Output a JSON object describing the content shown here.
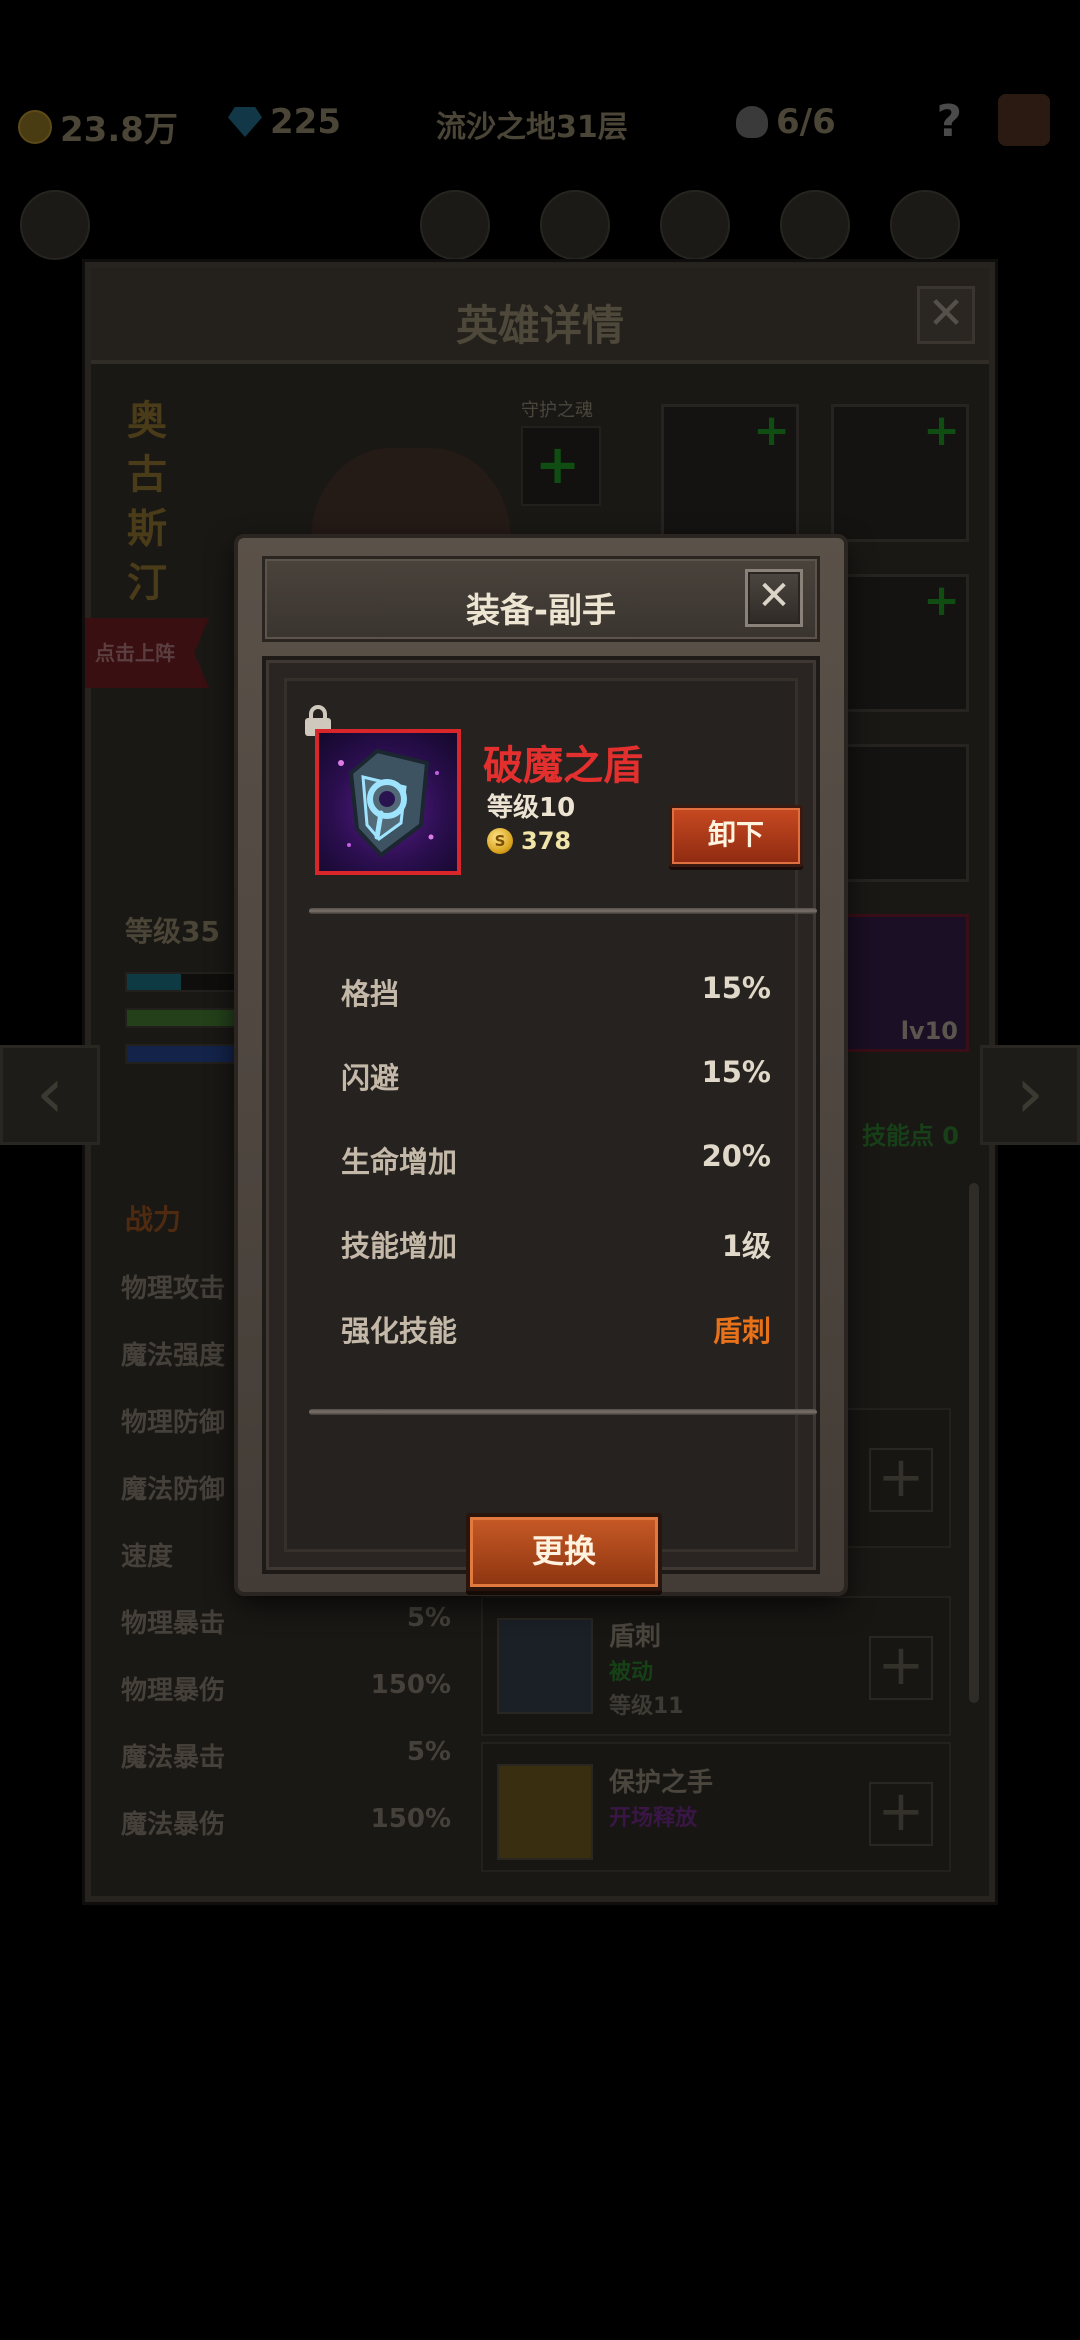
{
  "topbar": {
    "gold": "23.8万",
    "gems": "225",
    "stage": "流沙之地31层",
    "skulls": "6/6",
    "help": "?"
  },
  "hero_panel": {
    "title": "英雄详情",
    "close": "✕",
    "hero_name": "奥古斯汀",
    "guard_label": "守护之魂",
    "tap_deploy": "点击上阵",
    "level": "等级35",
    "skill_points": "技能点 0",
    "power_label": "战力",
    "stats": [
      {
        "label": "物理攻击",
        "value": ""
      },
      {
        "label": "魔法强度",
        "value": ""
      },
      {
        "label": "物理防御",
        "value": ""
      },
      {
        "label": "魔法防御",
        "value": ""
      },
      {
        "label": "速度",
        "value": ""
      },
      {
        "label": "物理暴击",
        "value": "5%"
      },
      {
        "label": "物理暴伤",
        "value": "150%"
      },
      {
        "label": "魔法暴击",
        "value": "5%"
      },
      {
        "label": "魔法暴伤",
        "value": "150%"
      }
    ],
    "equipped_badge": "lv10",
    "skills": [
      {
        "name": "盾刺",
        "type": "被动",
        "level": "等级11"
      },
      {
        "name": "保护之手",
        "type": "开场释放",
        "level": ""
      }
    ]
  },
  "dialog": {
    "title": "装备-副手",
    "close": "✕",
    "item": {
      "name": "破魔之盾",
      "level": "等级10",
      "price": "378",
      "coin_symbol": "S"
    },
    "unequip_label": "卸下",
    "attributes": [
      {
        "label": "格挡",
        "value": "15%"
      },
      {
        "label": "闪避",
        "value": "15%"
      },
      {
        "label": "生命增加",
        "value": "20%"
      },
      {
        "label": "技能增加",
        "value": "1级"
      },
      {
        "label": "强化技能",
        "value": "盾刺"
      }
    ],
    "replace_label": "更换"
  },
  "colors": {
    "item_name": "#e3302e",
    "highlight_value": "#e8721a",
    "item_border": "#d8262a"
  }
}
